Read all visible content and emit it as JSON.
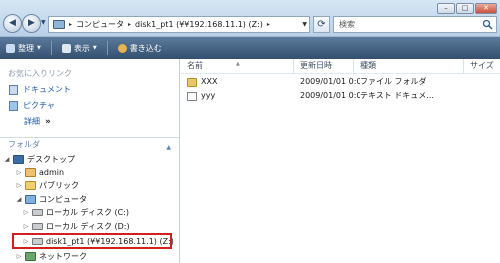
{
  "address": {
    "breadcrumb": [
      "コンピュータ",
      "disk1_pt1 (¥¥192.168.11.1) (Z:)"
    ],
    "search_placeholder": "検索"
  },
  "toolbar": {
    "organize": "整理",
    "views": "表示",
    "burn": "書き込む"
  },
  "navpane": {
    "favorites_title": "お気に入りリンク",
    "favorites": [
      "ドキュメント",
      "ピクチャ"
    ],
    "more": "詳細",
    "more_arrows": "»",
    "folders_title": "フォルダ",
    "tree": {
      "desktop": "デスクトップ",
      "admin": "admin",
      "public": "パブリック",
      "computer": "コンピュータ",
      "disk_c": "ローカル ディスク (C:)",
      "disk_d": "ローカル ディスク (D:)",
      "network_drive": "disk1_pt1 (¥¥192.168.11.1) (Z:)",
      "network": "ネットワーク"
    }
  },
  "content": {
    "columns": [
      "名前",
      "更新日時",
      "種類",
      "サイズ"
    ],
    "files": [
      {
        "name": "XXX",
        "modified": "2009/01/01 0:07",
        "type": "ファイル フォルダ",
        "icon": "folder-icon"
      },
      {
        "name": "yyy",
        "modified": "2009/01/01 0:07",
        "type": "テキスト ドキュメ...",
        "icon": "text-file-icon"
      }
    ]
  },
  "colors": {
    "toolbar": "#4a6a8e",
    "highlight_box": "#d21f1f",
    "link": "#1f5ba8"
  }
}
